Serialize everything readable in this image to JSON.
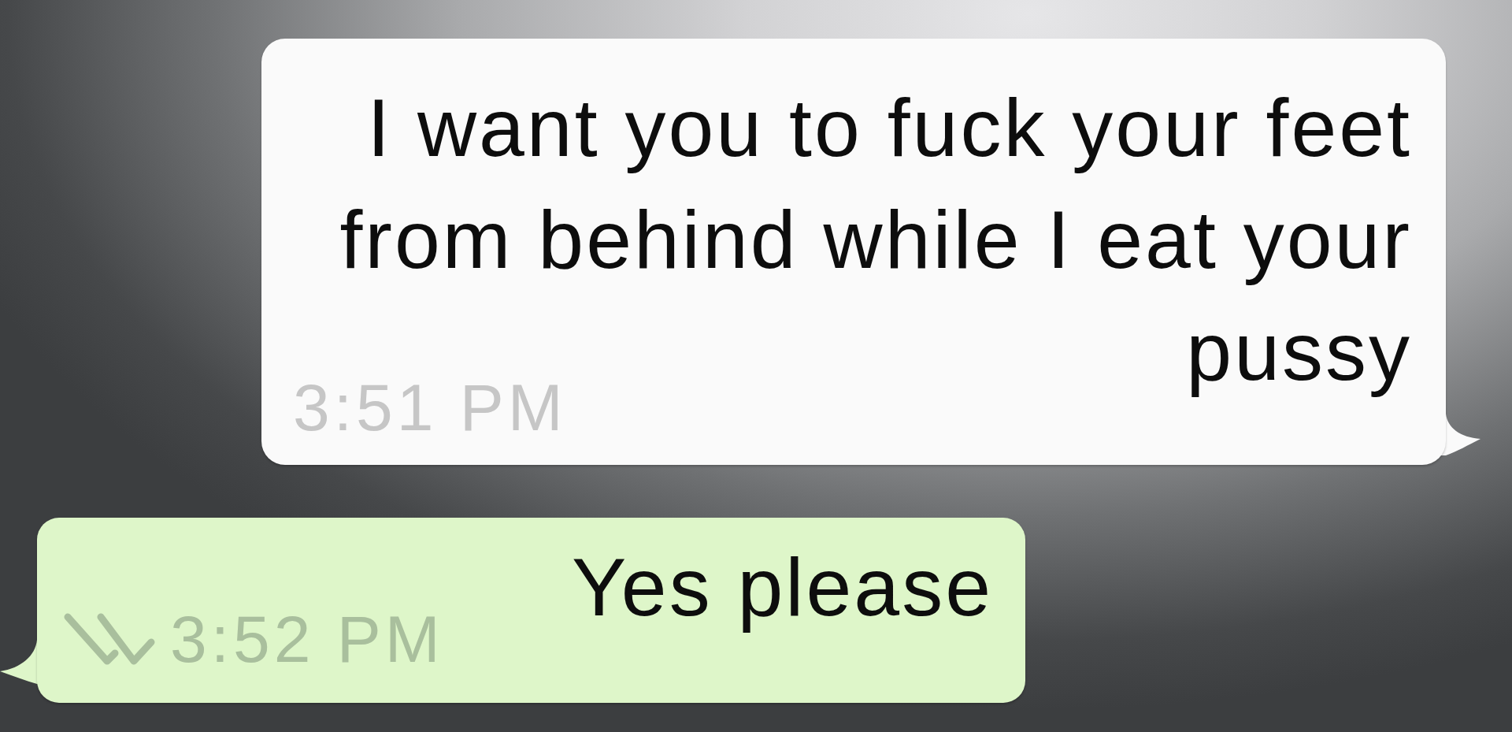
{
  "messages": [
    {
      "kind": "received",
      "text": "I want you to fuck your feet from behind while I eat your pussy",
      "time": "3:51 PM"
    },
    {
      "kind": "sent",
      "text": "Yes please",
      "time": "3:52 PM",
      "read": true
    }
  ]
}
